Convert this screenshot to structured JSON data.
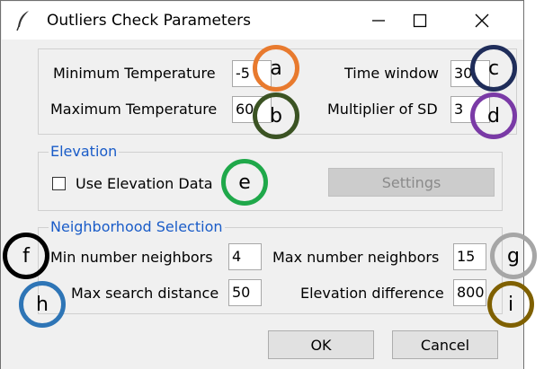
{
  "window": {
    "title": "Outliers Check Parameters",
    "controls": {
      "minimize": "minimize",
      "maximize": "maximize",
      "close": "close"
    }
  },
  "temperature": {
    "min_label": "Minimum Temperature",
    "min_value": "-5",
    "max_label": "Maximum Temperature",
    "max_value": "60",
    "time_window_label": "Time window",
    "time_window_value": "30",
    "multiplier_label": "Multiplier of SD",
    "multiplier_value": "3"
  },
  "elevation": {
    "section_title": "Elevation",
    "use_label": "Use Elevation Data",
    "use_checked": false,
    "settings_label": "Settings"
  },
  "neighborhood": {
    "section_title": "Neighborhood Selection",
    "min_neighbors_label": "Min number neighbors",
    "min_neighbors_value": "4",
    "max_neighbors_label": "Max number neighbors",
    "max_neighbors_value": "15",
    "max_distance_label": "Max search distance",
    "max_distance_value": "50",
    "elev_diff_label": "Elevation difference",
    "elev_diff_value": "800"
  },
  "buttons": {
    "ok": "OK",
    "cancel": "Cancel"
  },
  "annotations": [
    {
      "letter": "a",
      "color": "#e87a2e"
    },
    {
      "letter": "b",
      "color": "#3b5323"
    },
    {
      "letter": "c",
      "color": "#1f2d5a"
    },
    {
      "letter": "d",
      "color": "#7a3aa6"
    },
    {
      "letter": "e",
      "color": "#1fa84a"
    },
    {
      "letter": "f",
      "color": "#000000"
    },
    {
      "letter": "g",
      "color": "#a6a6a6"
    },
    {
      "letter": "h",
      "color": "#2e75b6"
    },
    {
      "letter": "i",
      "color": "#7f6000"
    }
  ]
}
